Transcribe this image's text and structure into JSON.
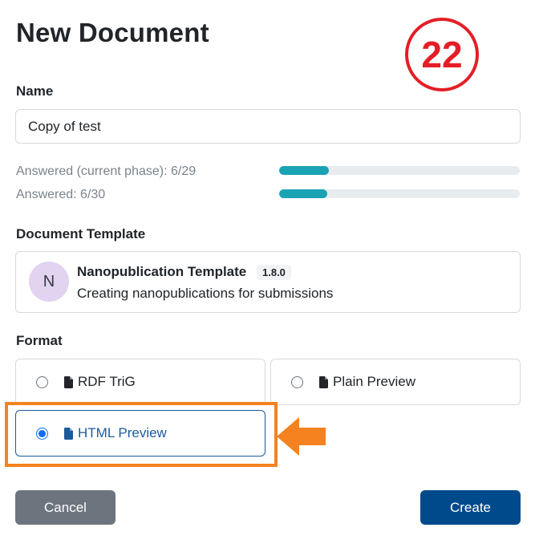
{
  "header": {
    "title": "New Document"
  },
  "step_badge": {
    "number": "22",
    "color": "#e41e26"
  },
  "name_field": {
    "label": "Name",
    "value": "Copy of test"
  },
  "progress": [
    {
      "label": "Answered (current phase): 6/29",
      "answered": 6,
      "total": 29
    },
    {
      "label": "Answered: 6/30",
      "answered": 6,
      "total": 30
    }
  ],
  "template_section": {
    "label": "Document Template",
    "card": {
      "avatar_letter": "N",
      "name": "Nanopublication Template",
      "version": "1.8.0",
      "description": "Creating nanopublications for submissions"
    }
  },
  "format_section": {
    "label": "Format",
    "options": [
      {
        "label": "RDF TriG",
        "selected": false,
        "icon": "file-icon"
      },
      {
        "label": "Plain Preview",
        "selected": false,
        "icon": "file-icon"
      },
      {
        "label": "HTML Preview",
        "selected": true,
        "icon": "file-icon"
      }
    ]
  },
  "annotation": {
    "highlight_color": "#f5821f",
    "arrow_icon": "arrow-left-icon"
  },
  "actions": {
    "cancel_label": "Cancel",
    "create_label": "Create"
  },
  "colors": {
    "accent": "#004a8c",
    "progress": "#1aa3b4",
    "selected_border": "#1d5a9a"
  }
}
